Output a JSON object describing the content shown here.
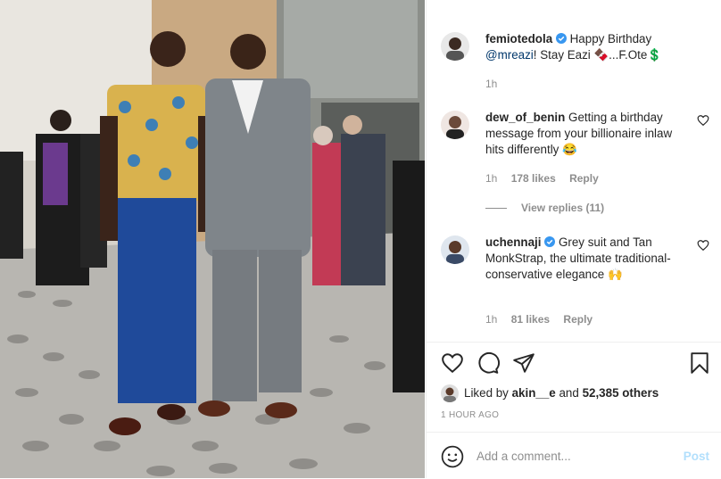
{
  "post": {
    "author": "femiotedola",
    "caption_pre": "Happy Birthday",
    "caption_mention": "@mreazi",
    "caption_post": "! Stay Eazi 🍫...F.Ote💲",
    "age": "1h"
  },
  "comments": [
    {
      "user": "dew_of_benin",
      "text": "Getting a birthday message from your billionaire inlaw hits differently 😂",
      "age": "1h",
      "likes": "178 likes",
      "reply": "Reply",
      "view_replies": "View replies (11)"
    },
    {
      "user": "uchennaji",
      "text": "Grey suit and Tan MonkStrap, the ultimate traditional-conservative elegance 🙌",
      "age": "1h",
      "likes": "81 likes",
      "reply": "Reply"
    }
  ],
  "likes": {
    "prefix": "Liked by",
    "user": "akin__e",
    "and": "and",
    "others": "52,385 others"
  },
  "timestamp": "1 HOUR AGO",
  "add_comment": {
    "placeholder": "Add a comment...",
    "post_label": "Post"
  },
  "colors": {
    "verified": "#3897f0",
    "mention": "#00376b",
    "muted": "#8e8e8e",
    "post_disabled": "#b2dffc"
  }
}
